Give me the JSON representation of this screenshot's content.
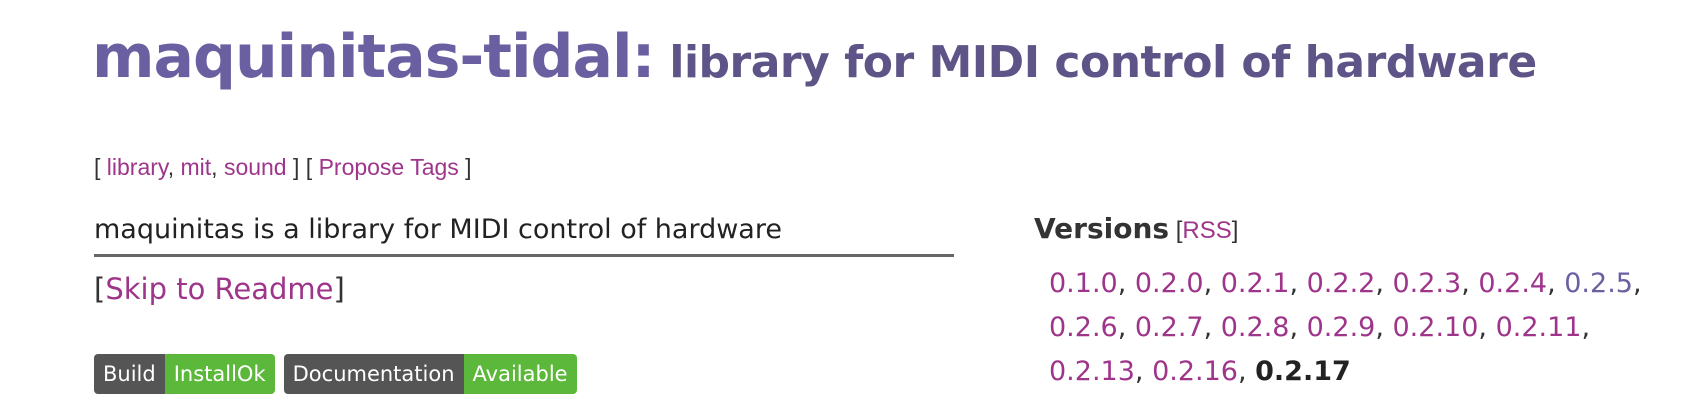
{
  "header": {
    "package_name": "maquinitas-tidal:",
    "summary": " library for MIDI control of hardware"
  },
  "tags": {
    "open": "[ ",
    "items": [
      "library",
      "mit",
      "sound"
    ],
    "separator": ", ",
    "between": " ] [ ",
    "propose_label": "Propose Tags",
    "close": " ]"
  },
  "description": "maquinitas is a library for MIDI control of hardware",
  "skip": {
    "open": "[",
    "label": "Skip to Readme",
    "close": "]"
  },
  "badges": [
    {
      "left": "Build",
      "right": "InstallOk"
    },
    {
      "left": "Documentation",
      "right": "Available"
    }
  ],
  "versions": {
    "title": "Versions",
    "rss_open": " [",
    "rss_label": "RSS",
    "rss_close": "]",
    "list": [
      "0.1.0",
      "0.2.0",
      "0.2.1",
      "0.2.2",
      "0.2.3",
      "0.2.4",
      "0.2.5",
      "0.2.6",
      "0.2.7",
      "0.2.8",
      "0.2.9",
      "0.2.10",
      "0.2.11",
      "0.2.13",
      "0.2.16",
      "0.2.17"
    ],
    "visited": "0.2.5",
    "current": "0.2.17",
    "separator": ", "
  },
  "colors": {
    "link": "#9e358b",
    "visited_link": "#6a5fa0",
    "title": "#6a5fa0",
    "badge_left": "#555555",
    "badge_right": "#5cb83a"
  }
}
